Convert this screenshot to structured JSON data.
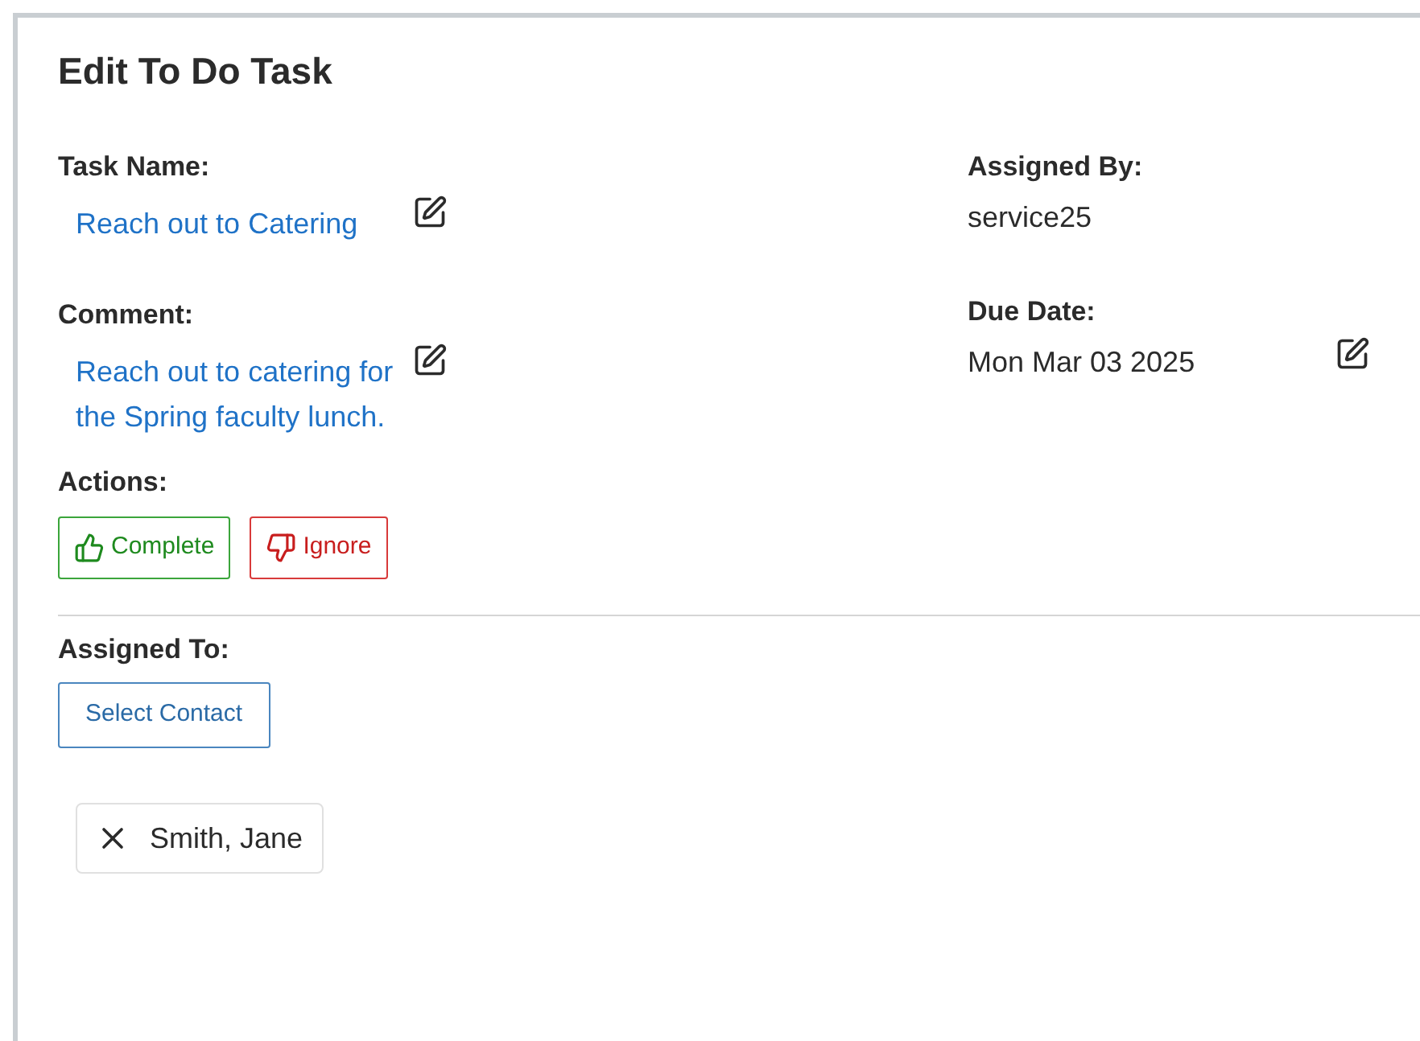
{
  "title": "Edit To Do Task",
  "fields_left": [
    {
      "label": "Task Name:",
      "value": "Reach out to Catering",
      "editable": true,
      "kind": "link"
    },
    {
      "label": "Comment:",
      "value": "Reach out to catering for the Spring faculty lunch.",
      "editable": true,
      "kind": "link"
    }
  ],
  "fields_right": [
    {
      "label": "Assigned By:",
      "value": "service25",
      "editable": false,
      "kind": "text"
    },
    {
      "label": "Due Date:",
      "value": "Mon Mar 03 2025",
      "editable": true,
      "kind": "text"
    }
  ],
  "actions": {
    "label": "Actions:",
    "buttons": [
      {
        "label": "Complete",
        "kind": "complete"
      },
      {
        "label": "Ignore",
        "kind": "ignore"
      }
    ]
  },
  "assigned_to": {
    "label": "Assigned To:",
    "button": "Select Contact",
    "contacts": [
      "Smith, Jane"
    ]
  }
}
